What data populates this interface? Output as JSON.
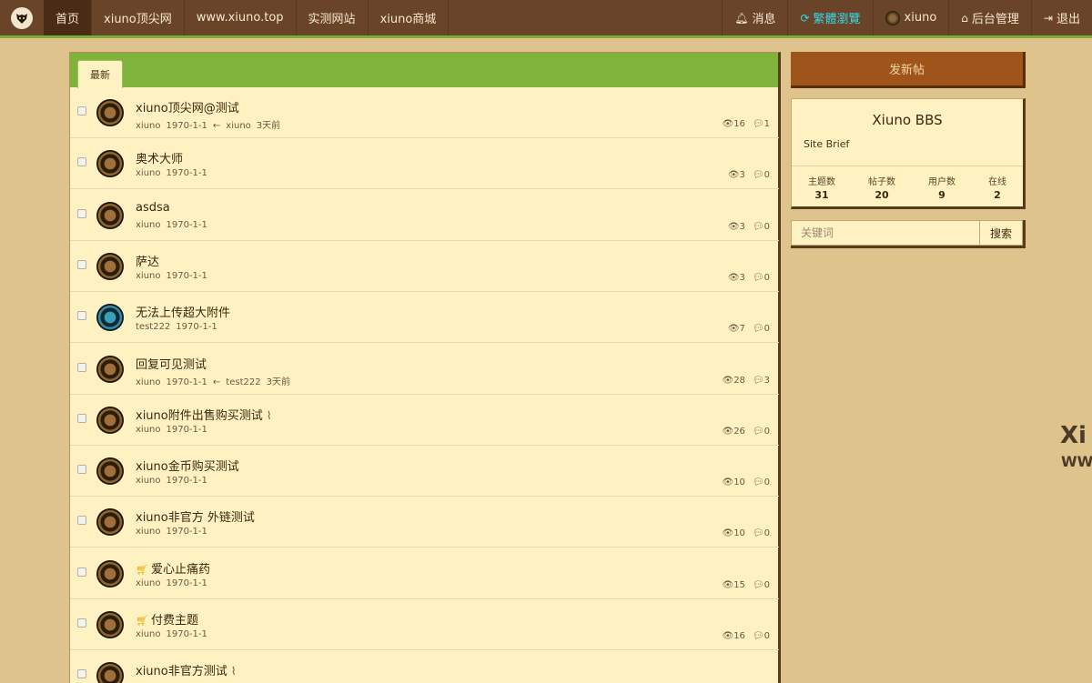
{
  "nav": {
    "logo": "logo-icon",
    "items": [
      {
        "label": "首页"
      },
      {
        "label": "xiuno顶尖网"
      },
      {
        "label": "www.xiuno.top"
      },
      {
        "label": "实测网站"
      },
      {
        "label": "xiuno商城"
      }
    ],
    "right": {
      "messages": "消息",
      "traditional": "繁體瀏覽",
      "user": "xiuno",
      "admin": "后台管理",
      "logout": "退出"
    }
  },
  "forum": {
    "tab_latest": "最新",
    "threads": [
      {
        "title": "xiuno顶尖网@测试",
        "author": "xiuno",
        "date": "1970-1-1",
        "last_user": "xiuno",
        "last_time": "3天前",
        "views": "16",
        "replies": "1",
        "cart": false,
        "clip": false,
        "avatar": "default"
      },
      {
        "title": "奥术大师",
        "author": "xiuno",
        "date": "1970-1-1",
        "last_user": "",
        "last_time": "",
        "views": "3",
        "replies": "0",
        "cart": false,
        "clip": false,
        "avatar": "default"
      },
      {
        "title": "asdsa",
        "author": "xiuno",
        "date": "1970-1-1",
        "last_user": "",
        "last_time": "",
        "views": "3",
        "replies": "0",
        "cart": false,
        "clip": false,
        "avatar": "default"
      },
      {
        "title": "萨达",
        "author": "xiuno",
        "date": "1970-1-1",
        "last_user": "",
        "last_time": "",
        "views": "3",
        "replies": "0",
        "cart": false,
        "clip": false,
        "avatar": "default"
      },
      {
        "title": "无法上传超大附件",
        "author": "test222",
        "date": "1970-1-1",
        "last_user": "",
        "last_time": "",
        "views": "7",
        "replies": "0",
        "cart": false,
        "clip": false,
        "avatar": "blue"
      },
      {
        "title": "回复可见测试",
        "author": "xiuno",
        "date": "1970-1-1",
        "last_user": "test222",
        "last_time": "3天前",
        "views": "28",
        "replies": "3",
        "cart": false,
        "clip": false,
        "avatar": "default"
      },
      {
        "title": "xiuno附件出售购买测试",
        "author": "xiuno",
        "date": "1970-1-1",
        "last_user": "",
        "last_time": "",
        "views": "26",
        "replies": "0",
        "cart": false,
        "clip": true,
        "avatar": "default"
      },
      {
        "title": "xiuno金币购买测试",
        "author": "xiuno",
        "date": "1970-1-1",
        "last_user": "",
        "last_time": "",
        "views": "10",
        "replies": "0",
        "cart": false,
        "clip": false,
        "avatar": "default"
      },
      {
        "title": "xiuno非官方 外链测试",
        "author": "xiuno",
        "date": "1970-1-1",
        "last_user": "",
        "last_time": "",
        "views": "10",
        "replies": "0",
        "cart": false,
        "clip": false,
        "avatar": "default"
      },
      {
        "title": "爱心止痛药",
        "author": "xiuno",
        "date": "1970-1-1",
        "last_user": "",
        "last_time": "",
        "views": "15",
        "replies": "0",
        "cart": true,
        "clip": false,
        "avatar": "default"
      },
      {
        "title": "付费主题",
        "author": "xiuno",
        "date": "1970-1-1",
        "last_user": "",
        "last_time": "",
        "views": "16",
        "replies": "0",
        "cart": true,
        "clip": false,
        "avatar": "default"
      },
      {
        "title": "xiuno非官方测试",
        "author": "",
        "date": "",
        "last_user": "",
        "last_time": "",
        "views": "",
        "replies": "",
        "cart": false,
        "clip": true,
        "avatar": "default"
      }
    ]
  },
  "sidebar": {
    "new_post": "发新帖",
    "site_name": "Xiuno BBS",
    "site_brief": "Site Brief",
    "stats": [
      {
        "label": "主题数",
        "value": "31"
      },
      {
        "label": "帖子数",
        "value": "20"
      },
      {
        "label": "用户数",
        "value": "9"
      },
      {
        "label": "在线",
        "value": "2"
      }
    ],
    "search_placeholder": "关键词",
    "search_button": "搜索"
  },
  "edge": {
    "mark1": "Xi",
    "mark2": "WW"
  },
  "colors": {
    "navbar": "#6a4428",
    "accent_green": "#7fb33c",
    "button_brown": "#9e541a",
    "card_bg": "#fff2c2",
    "page_bg": "#dfc38c"
  }
}
